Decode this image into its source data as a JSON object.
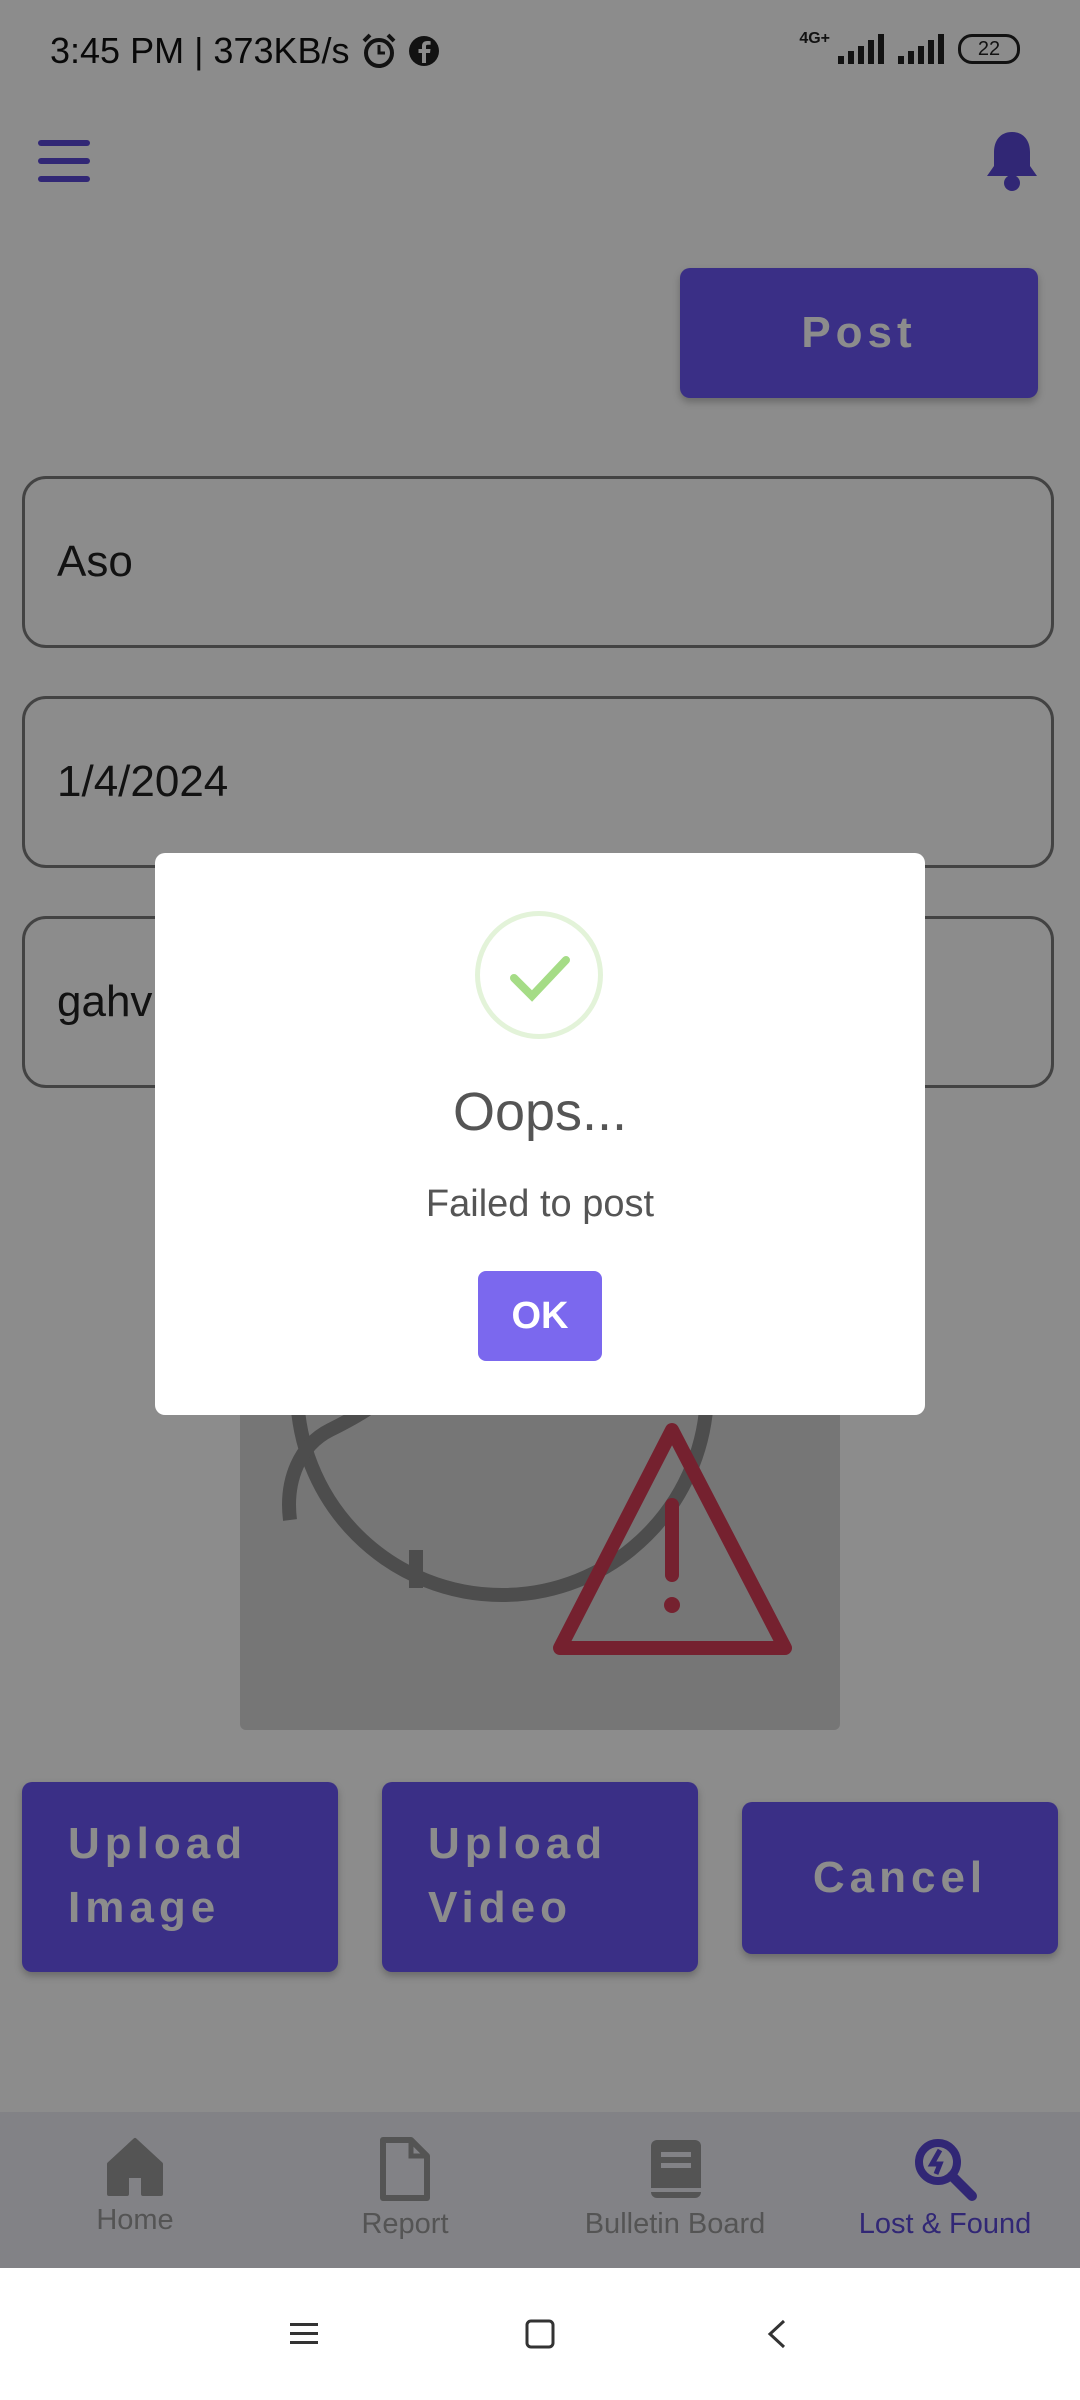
{
  "status_bar": {
    "time_speed": "3:45 PM | 373KB/s",
    "network": "4G+",
    "battery": "22"
  },
  "toolbar": {
    "post_label": "Post"
  },
  "form": {
    "field1": "Aso",
    "field2": "1/4/2024",
    "field3": "gahv"
  },
  "actions": {
    "upload_image_line1": "Upload",
    "upload_image_line2": "Image",
    "upload_video_line1": "Upload",
    "upload_video_line2": "Video",
    "cancel": "Cancel"
  },
  "bottom_nav": {
    "items": [
      {
        "label": "Home",
        "icon": "home-icon"
      },
      {
        "label": "Report",
        "icon": "document-icon"
      },
      {
        "label": "Bulletin Board",
        "icon": "book-icon"
      },
      {
        "label": "Lost & Found",
        "icon": "search-icon",
        "active": true
      }
    ]
  },
  "dialog": {
    "title": "Oops...",
    "message": "Failed to post",
    "ok_label": "OK"
  },
  "colors": {
    "accent": "#6a56f5",
    "ok_button": "#7b68ee",
    "success_check": "#a5dc86",
    "warning": "#d63c57"
  }
}
